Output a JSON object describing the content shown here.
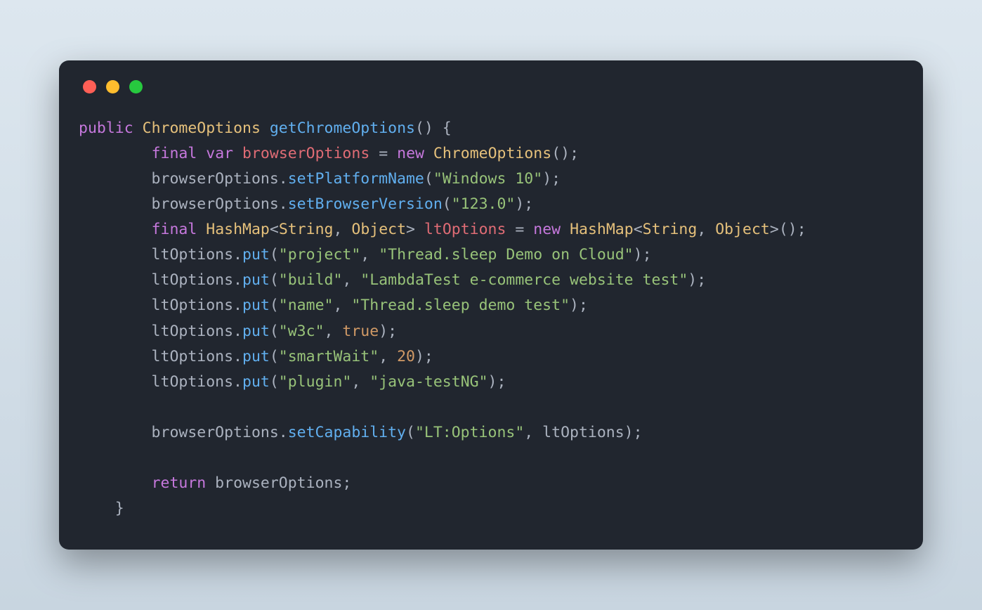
{
  "trafficLights": [
    "red",
    "yellow",
    "green"
  ],
  "tokens": [
    [
      {
        "c": "kw",
        "t": "public"
      },
      {
        "c": "punc",
        "t": " "
      },
      {
        "c": "type",
        "t": "ChromeOptions"
      },
      {
        "c": "punc",
        "t": " "
      },
      {
        "c": "method",
        "t": "getChromeOptions"
      },
      {
        "c": "punc",
        "t": "() {"
      }
    ],
    [
      {
        "c": "punc",
        "t": "        "
      },
      {
        "c": "kw",
        "t": "final"
      },
      {
        "c": "punc",
        "t": " "
      },
      {
        "c": "kw",
        "t": "var"
      },
      {
        "c": "punc",
        "t": " "
      },
      {
        "c": "var",
        "t": "browserOptions"
      },
      {
        "c": "punc",
        "t": " "
      },
      {
        "c": "punc",
        "t": "="
      },
      {
        "c": "punc",
        "t": " "
      },
      {
        "c": "kw",
        "t": "new"
      },
      {
        "c": "punc",
        "t": " "
      },
      {
        "c": "type",
        "t": "ChromeOptions"
      },
      {
        "c": "punc",
        "t": "();"
      }
    ],
    [
      {
        "c": "punc",
        "t": "        browserOptions."
      },
      {
        "c": "method",
        "t": "setPlatformName"
      },
      {
        "c": "punc",
        "t": "("
      },
      {
        "c": "str",
        "t": "\"Windows 10\""
      },
      {
        "c": "punc",
        "t": ");"
      }
    ],
    [
      {
        "c": "punc",
        "t": "        browserOptions."
      },
      {
        "c": "method",
        "t": "setBrowserVersion"
      },
      {
        "c": "punc",
        "t": "("
      },
      {
        "c": "str",
        "t": "\"123.0\""
      },
      {
        "c": "punc",
        "t": ");"
      }
    ],
    [
      {
        "c": "punc",
        "t": "        "
      },
      {
        "c": "kw",
        "t": "final"
      },
      {
        "c": "punc",
        "t": " "
      },
      {
        "c": "type",
        "t": "HashMap"
      },
      {
        "c": "punc",
        "t": "<"
      },
      {
        "c": "type",
        "t": "String"
      },
      {
        "c": "punc",
        "t": ", "
      },
      {
        "c": "type",
        "t": "Object"
      },
      {
        "c": "punc",
        "t": "> "
      },
      {
        "c": "var",
        "t": "ltOptions"
      },
      {
        "c": "punc",
        "t": " = "
      },
      {
        "c": "kw",
        "t": "new"
      },
      {
        "c": "punc",
        "t": " "
      },
      {
        "c": "type",
        "t": "HashMap"
      },
      {
        "c": "punc",
        "t": "<"
      },
      {
        "c": "type",
        "t": "String"
      },
      {
        "c": "punc",
        "t": ", "
      },
      {
        "c": "type",
        "t": "Object"
      },
      {
        "c": "punc",
        "t": ">();"
      }
    ],
    [
      {
        "c": "punc",
        "t": "        ltOptions."
      },
      {
        "c": "method",
        "t": "put"
      },
      {
        "c": "punc",
        "t": "("
      },
      {
        "c": "str",
        "t": "\"project\""
      },
      {
        "c": "punc",
        "t": ", "
      },
      {
        "c": "str",
        "t": "\"Thread.sleep Demo on Cloud\""
      },
      {
        "c": "punc",
        "t": ");"
      }
    ],
    [
      {
        "c": "punc",
        "t": "        ltOptions."
      },
      {
        "c": "method",
        "t": "put"
      },
      {
        "c": "punc",
        "t": "("
      },
      {
        "c": "str",
        "t": "\"build\""
      },
      {
        "c": "punc",
        "t": ", "
      },
      {
        "c": "str",
        "t": "\"LambdaTest e-commerce website test\""
      },
      {
        "c": "punc",
        "t": ");"
      }
    ],
    [
      {
        "c": "punc",
        "t": "        ltOptions."
      },
      {
        "c": "method",
        "t": "put"
      },
      {
        "c": "punc",
        "t": "("
      },
      {
        "c": "str",
        "t": "\"name\""
      },
      {
        "c": "punc",
        "t": ", "
      },
      {
        "c": "str",
        "t": "\"Thread.sleep demo test\""
      },
      {
        "c": "punc",
        "t": ");"
      }
    ],
    [
      {
        "c": "punc",
        "t": "        ltOptions."
      },
      {
        "c": "method",
        "t": "put"
      },
      {
        "c": "punc",
        "t": "("
      },
      {
        "c": "str",
        "t": "\"w3c\""
      },
      {
        "c": "punc",
        "t": ", "
      },
      {
        "c": "bool",
        "t": "true"
      },
      {
        "c": "punc",
        "t": ");"
      }
    ],
    [
      {
        "c": "punc",
        "t": "        ltOptions."
      },
      {
        "c": "method",
        "t": "put"
      },
      {
        "c": "punc",
        "t": "("
      },
      {
        "c": "str",
        "t": "\"smartWait\""
      },
      {
        "c": "punc",
        "t": ", "
      },
      {
        "c": "num",
        "t": "20"
      },
      {
        "c": "punc",
        "t": ");"
      }
    ],
    [
      {
        "c": "punc",
        "t": "        ltOptions."
      },
      {
        "c": "method",
        "t": "put"
      },
      {
        "c": "punc",
        "t": "("
      },
      {
        "c": "str",
        "t": "\"plugin\""
      },
      {
        "c": "punc",
        "t": ", "
      },
      {
        "c": "str",
        "t": "\"java-testNG\""
      },
      {
        "c": "punc",
        "t": ");"
      }
    ],
    [
      {
        "c": "punc",
        "t": ""
      }
    ],
    [
      {
        "c": "punc",
        "t": "        browserOptions."
      },
      {
        "c": "method",
        "t": "setCapability"
      },
      {
        "c": "punc",
        "t": "("
      },
      {
        "c": "str",
        "t": "\"LT:Options\""
      },
      {
        "c": "punc",
        "t": ", ltOptions);"
      }
    ],
    [
      {
        "c": "punc",
        "t": ""
      }
    ],
    [
      {
        "c": "punc",
        "t": "        "
      },
      {
        "c": "kw",
        "t": "return"
      },
      {
        "c": "punc",
        "t": " browserOptions;"
      }
    ],
    [
      {
        "c": "punc",
        "t": "    }"
      }
    ]
  ]
}
